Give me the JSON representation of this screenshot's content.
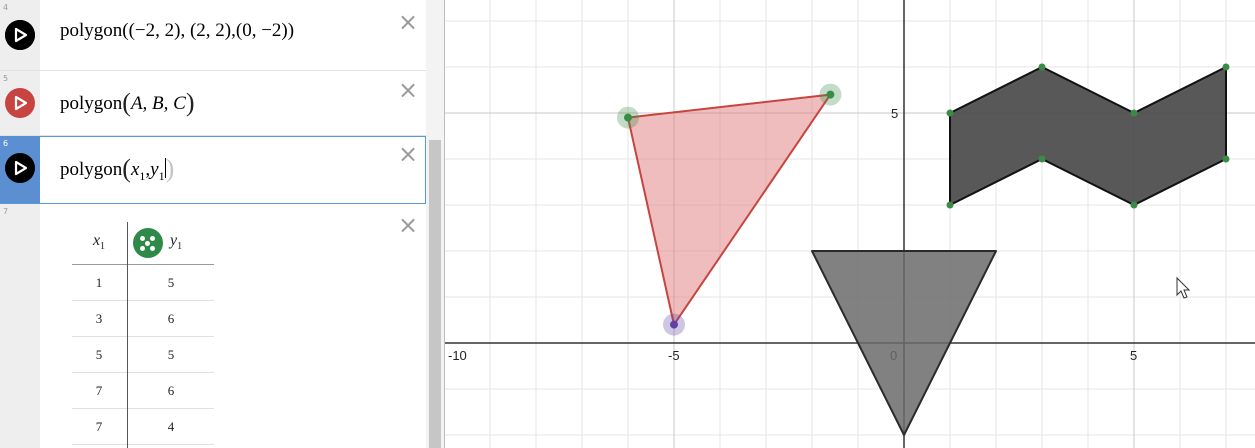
{
  "expressions": [
    {
      "number": "4",
      "fn": "polygon",
      "content": "((−2, 2), (2, 2),(0, −2))",
      "color": "#000000"
    },
    {
      "number": "5",
      "fn": "polygon",
      "content": "A, B, C",
      "color": "#c74440"
    },
    {
      "number": "6",
      "fn": "polygon",
      "var1": "x",
      "sub1": "1",
      "var2": "y",
      "sub2": "1",
      "color": "#000000"
    },
    {
      "number": "7"
    }
  ],
  "close_label": "×",
  "table": {
    "col1": {
      "var": "x",
      "sub": "1"
    },
    "col2": {
      "var": "y",
      "sub": "1"
    },
    "rows": [
      [
        "1",
        "5"
      ],
      [
        "3",
        "6"
      ],
      [
        "5",
        "5"
      ],
      [
        "7",
        "6"
      ],
      [
        "7",
        "4"
      ]
    ],
    "icon_color": "#2f8a4a"
  },
  "graph": {
    "x_tick_labels": [
      "-10",
      "-5",
      "0",
      "5"
    ],
    "y_tick_labels": [
      "5"
    ],
    "triangle_red": {
      "points": [
        [
          -6,
          4.9
        ],
        [
          -1.6,
          5.4
        ],
        [
          -5,
          0.4
        ]
      ],
      "fill": "#e07b7b",
      "stroke": "#c74440"
    },
    "triangle_gray": {
      "points": [
        [
          -2,
          2
        ],
        [
          2,
          2
        ],
        [
          0,
          -2
        ]
      ],
      "fill": "#6b6b6b",
      "stroke": "#2a2a2a"
    },
    "zigzag": {
      "points": [
        [
          1,
          5
        ],
        [
          3,
          6
        ],
        [
          5,
          5
        ],
        [
          7,
          6
        ],
        [
          7,
          4
        ],
        [
          5,
          3
        ],
        [
          3,
          4
        ],
        [
          1,
          3
        ]
      ],
      "fill": "#4f4f4f",
      "stroke": "#111111"
    },
    "point_colors": {
      "green": "#388c46",
      "purple": "#6042a6"
    }
  }
}
